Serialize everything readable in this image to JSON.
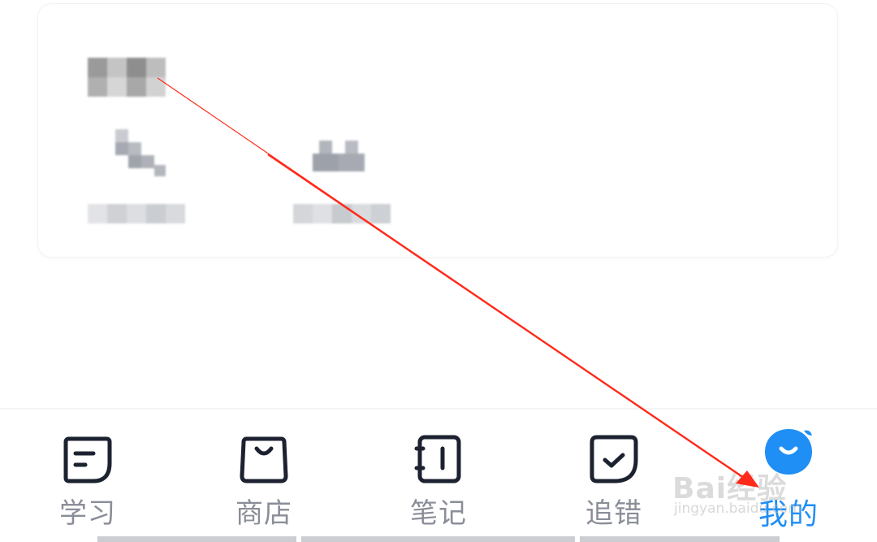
{
  "theme": {
    "accent": "#1f8ff5",
    "inactive": "#8a8e98",
    "icon_stroke": "#1c2230",
    "annotation": "#ff2a1a"
  },
  "card": {
    "title_blurred": "",
    "items": [
      {
        "icon": "phone-icon",
        "label_blurred": ""
      },
      {
        "icon": "people-icon",
        "label_blurred": ""
      }
    ]
  },
  "tabbar": {
    "tabs": [
      {
        "label": "学习",
        "icon": "study-icon",
        "active": false
      },
      {
        "label": "商店",
        "icon": "shop-bag-icon",
        "active": false
      },
      {
        "label": "笔记",
        "icon": "notebook-icon",
        "active": false
      },
      {
        "label": "追错",
        "icon": "check-note-icon",
        "active": false
      },
      {
        "label": "我的",
        "icon": "profile-face-icon",
        "active": true
      }
    ]
  },
  "watermark": {
    "main": "Bai经验",
    "sub": "jingyan.baidu.com"
  }
}
